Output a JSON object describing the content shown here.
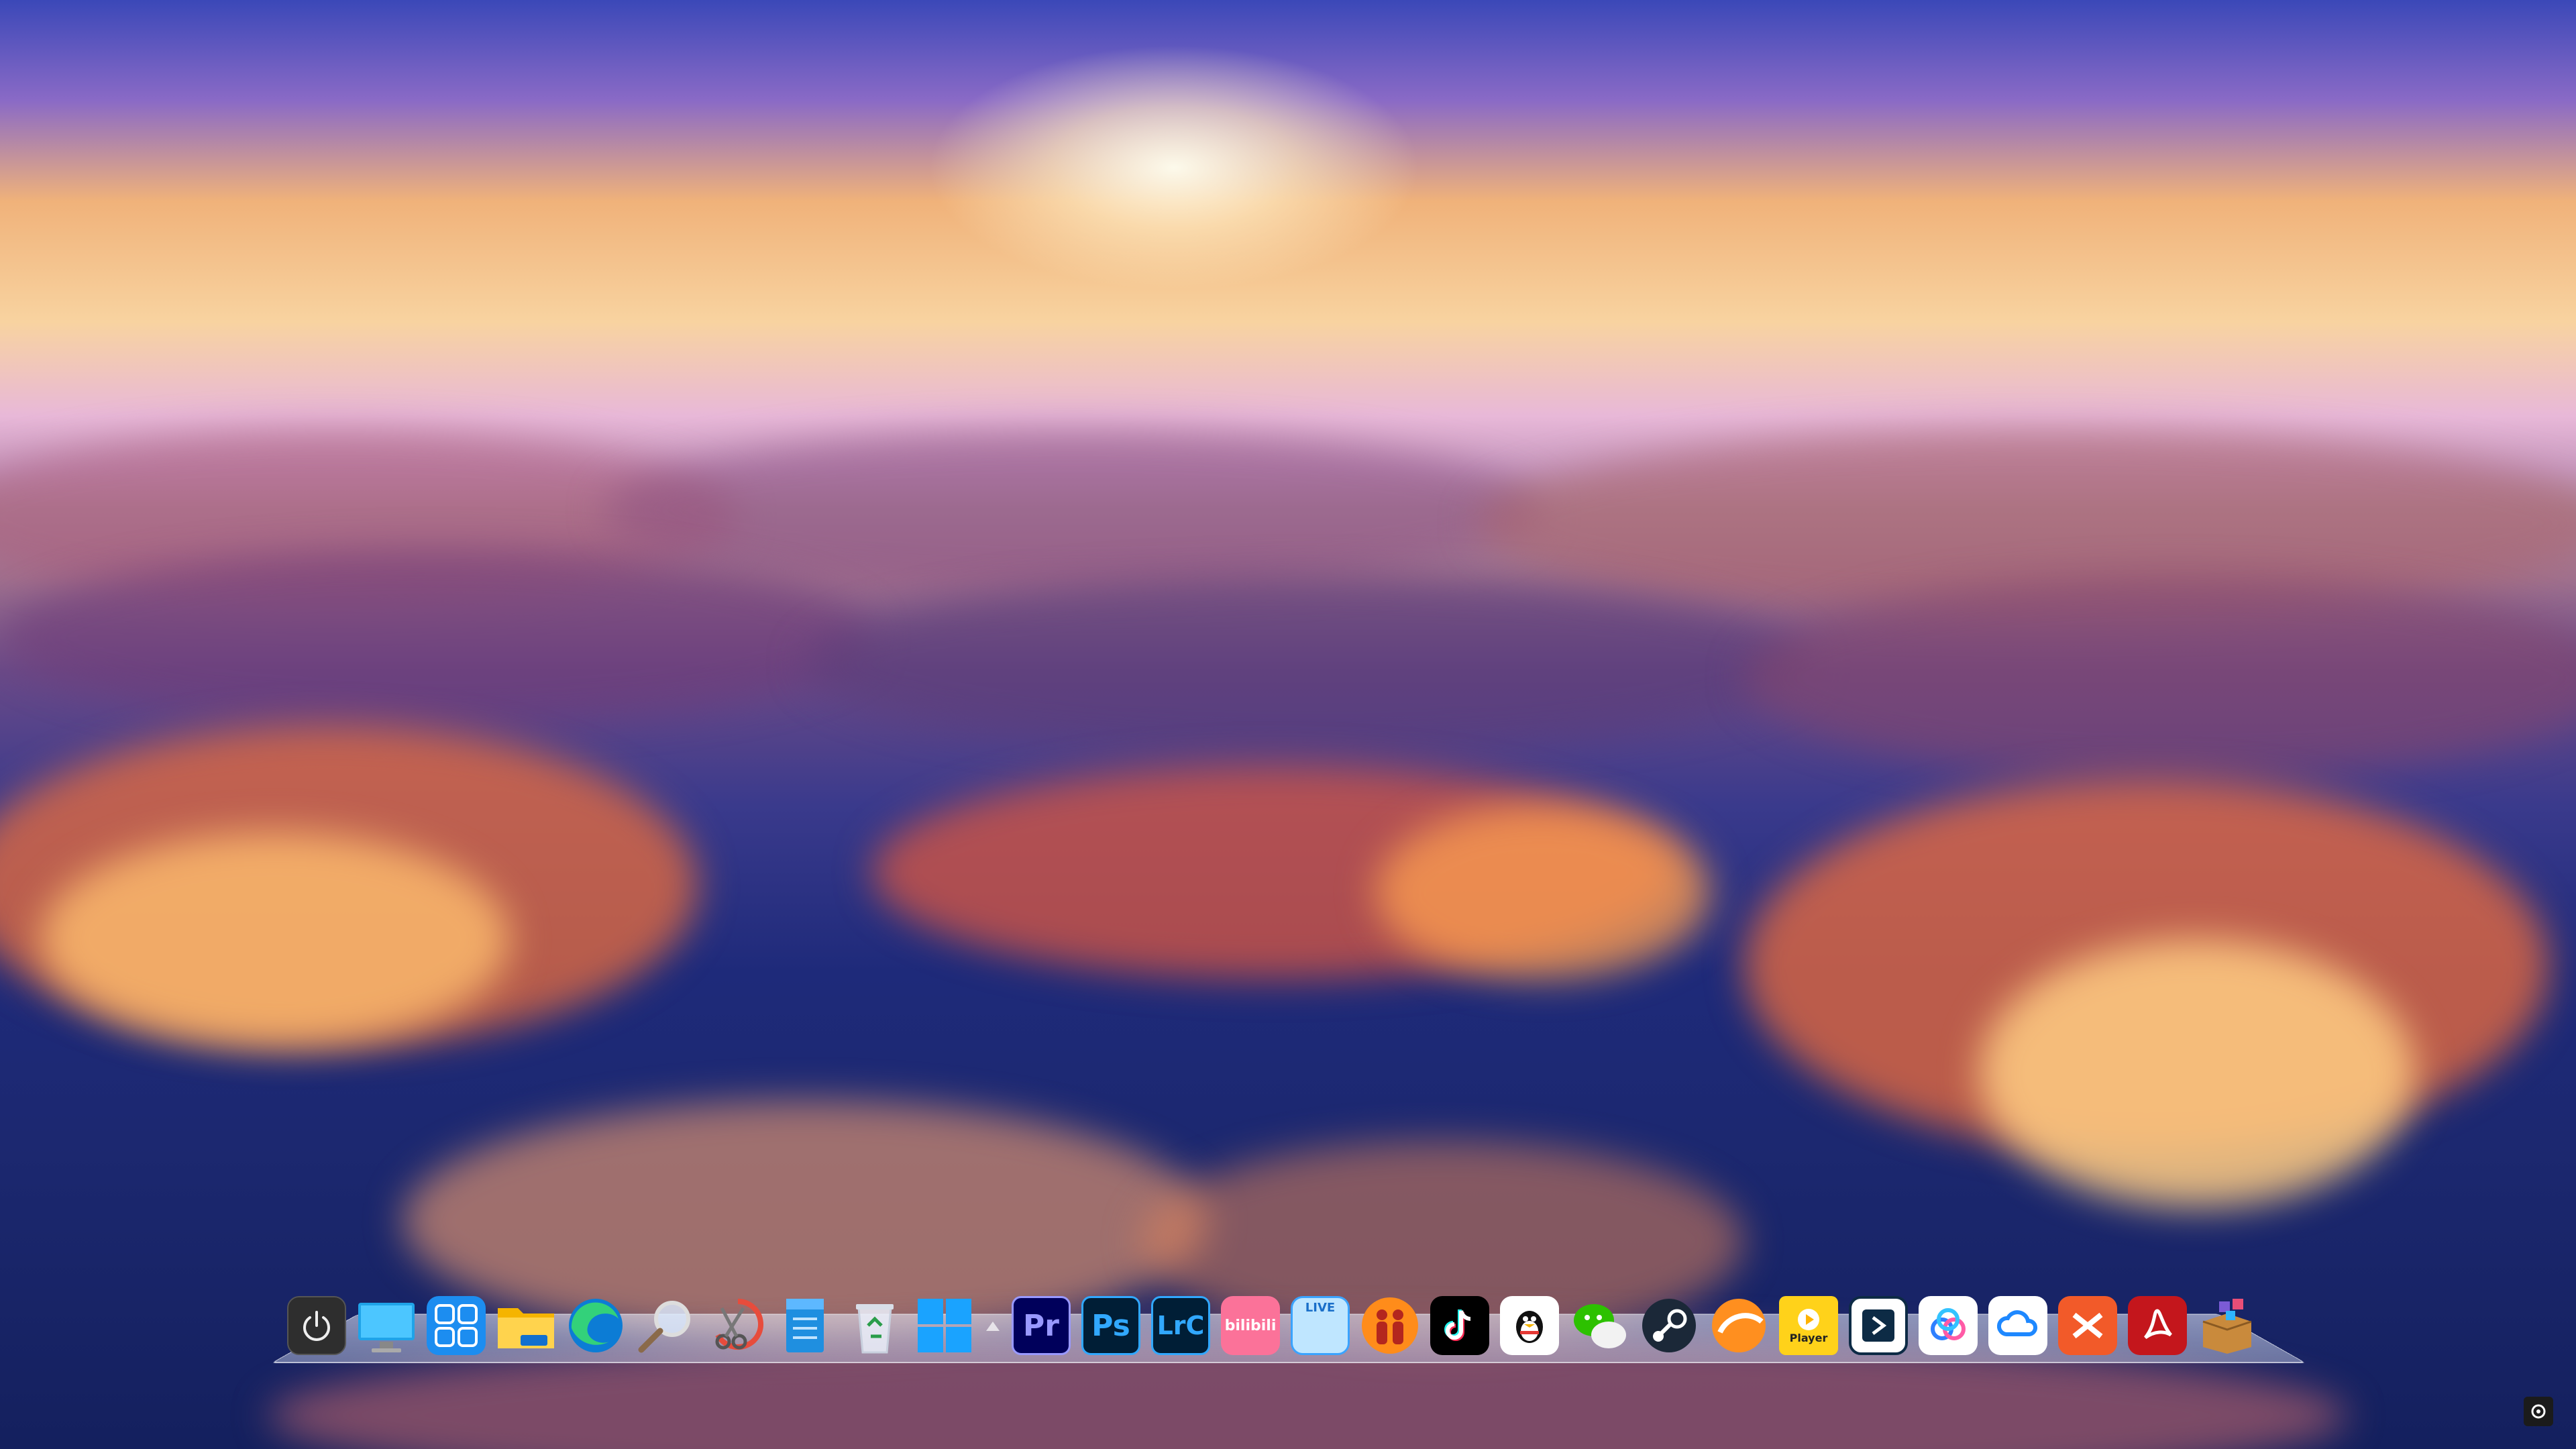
{
  "desktop": {
    "wallpaper_description": "",
    "dock": {
      "items": [
        {
          "name": "power-button",
          "icon": "power-icon"
        },
        {
          "name": "this-pc",
          "icon": "monitor-icon"
        },
        {
          "name": "control-panel",
          "icon": "grid-icon"
        },
        {
          "name": "file-explorer",
          "icon": "folder-icon"
        },
        {
          "name": "edge",
          "icon": "edge-icon"
        },
        {
          "name": "search",
          "icon": "magnifier-icon"
        },
        {
          "name": "snipping-tool",
          "icon": "scissors-icon"
        },
        {
          "name": "notepad",
          "icon": "notepad-icon"
        },
        {
          "name": "recycle-bin",
          "icon": "recycle-bin-icon"
        },
        {
          "name": "start-menu",
          "icon": "windows-icon"
        },
        {
          "name": "premiere-pro",
          "icon": "premiere-icon",
          "label": "Pr"
        },
        {
          "name": "photoshop",
          "icon": "photoshop-icon",
          "label": "Ps"
        },
        {
          "name": "lightroom-classic",
          "icon": "lightroom-icon",
          "label": "LrC"
        },
        {
          "name": "bilibili",
          "icon": "bilibili-icon",
          "label": "bilibili"
        },
        {
          "name": "bilibili-live",
          "icon": "live-icon",
          "label": "LIVE"
        },
        {
          "name": "couple-app",
          "icon": "couple-icon"
        },
        {
          "name": "tiktok",
          "icon": "tiktok-icon"
        },
        {
          "name": "qq",
          "icon": "penguin-icon"
        },
        {
          "name": "wechat",
          "icon": "wechat-icon"
        },
        {
          "name": "steam",
          "icon": "steam-icon"
        },
        {
          "name": "thunder",
          "icon": "orange-circle-icon"
        },
        {
          "name": "video-player",
          "icon": "player-icon",
          "label": "Player"
        },
        {
          "name": "remote-desktop",
          "icon": "remote-icon"
        },
        {
          "name": "baidu-netdisk",
          "icon": "cloud-ring-icon"
        },
        {
          "name": "cloud-drive",
          "icon": "cloud-icon"
        },
        {
          "name": "xmind",
          "icon": "xmind-icon"
        },
        {
          "name": "acrobat",
          "icon": "pdf-icon"
        },
        {
          "name": "app-box",
          "icon": "box-icon"
        }
      ]
    },
    "colors": {
      "premiere_bg": "#00005b",
      "premiere_fg": "#9999ff",
      "photoshop_bg": "#001e36",
      "photoshop_fg": "#31a8ff",
      "lightroom_bg": "#001e36",
      "lightroom_fg": "#31a8ff",
      "bilibili_bg": "#fb7299",
      "acrobat_bg": "#c4161c"
    }
  }
}
